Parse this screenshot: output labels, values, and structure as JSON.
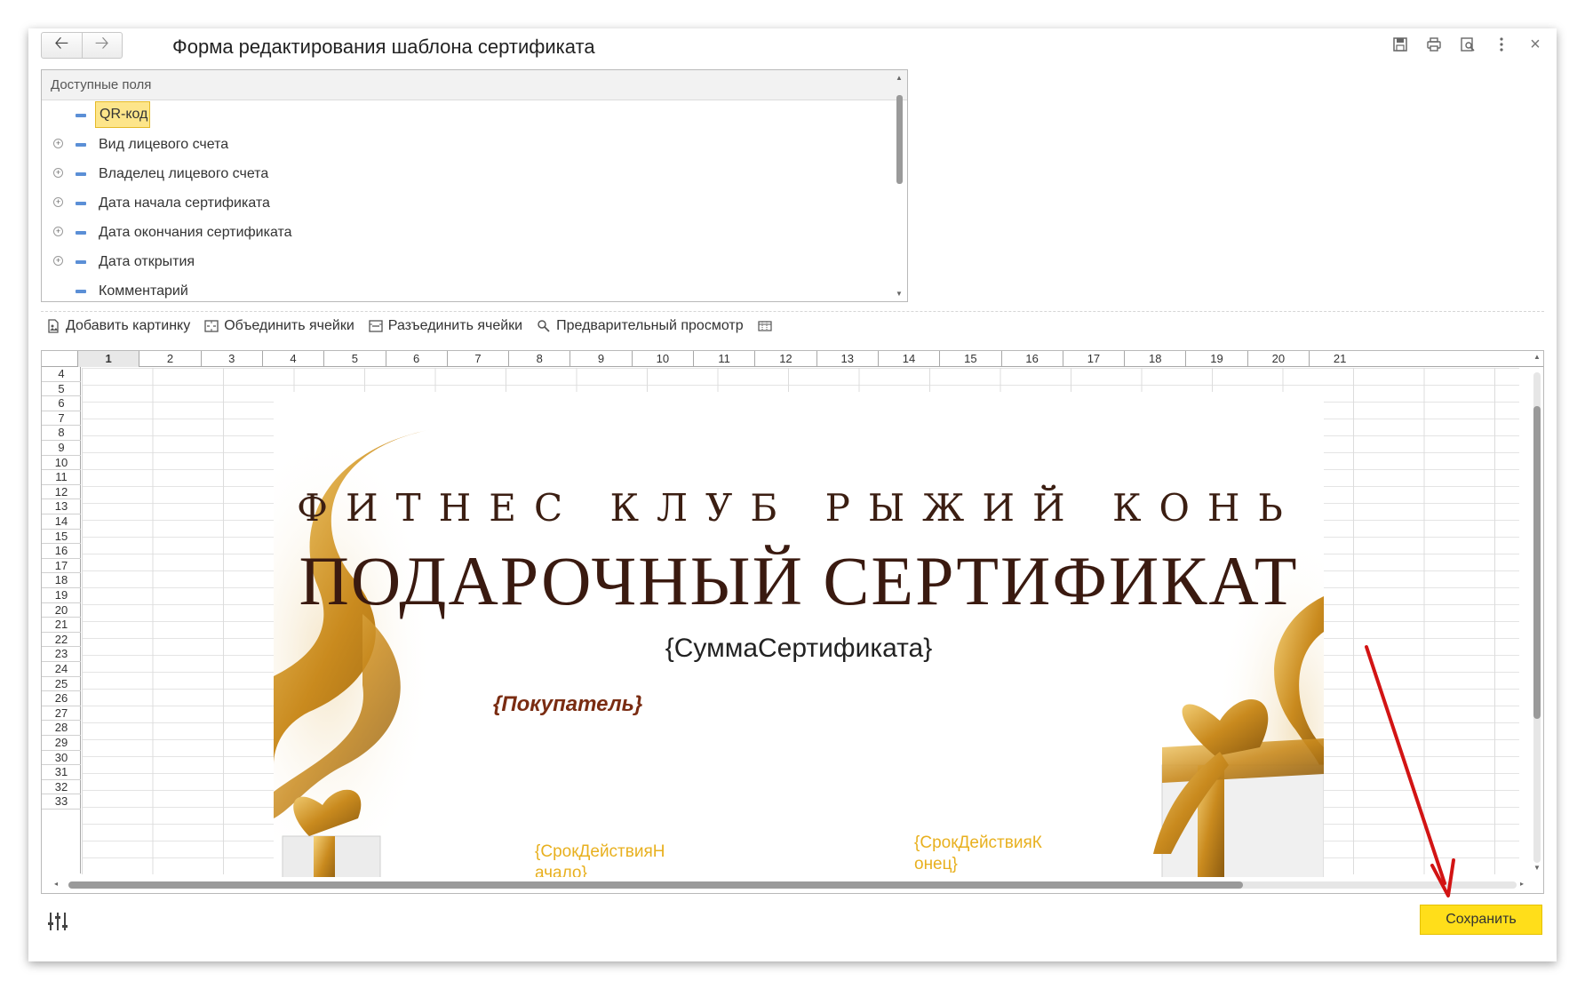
{
  "window": {
    "title": "Форма редактирования шаблона сертификата",
    "nav": {
      "back_icon": "arrow-left-icon",
      "forward_icon": "arrow-right-icon"
    },
    "tools": [
      "save-icon",
      "print-icon",
      "preview-icon",
      "more-icon",
      "close-icon"
    ],
    "close_glyph": "×"
  },
  "fields_panel": {
    "header": "Доступные поля",
    "items": [
      {
        "label": "QR-код",
        "expandable": false,
        "selected": true
      },
      {
        "label": "Вид лицевого счета",
        "expandable": true,
        "selected": false
      },
      {
        "label": "Владелец лицевого счета",
        "expandable": true,
        "selected": false
      },
      {
        "label": "Дата начала сертификата",
        "expandable": true,
        "selected": false
      },
      {
        "label": "Дата окончания сертификата",
        "expandable": true,
        "selected": false
      },
      {
        "label": "Дата открытия",
        "expandable": true,
        "selected": false
      },
      {
        "label": "Комментарий",
        "expandable": false,
        "selected": false
      }
    ]
  },
  "toolbar": {
    "add_picture": "Добавить картинку",
    "merge_cells": "Объединить ячейки",
    "split_cells": "Разъединить ячейки",
    "preview": "Предварительный просмотр"
  },
  "sheet": {
    "columns": [
      "1",
      "2",
      "3",
      "4",
      "5",
      "6",
      "7",
      "8",
      "9",
      "10",
      "11",
      "12",
      "13",
      "14",
      "15",
      "16",
      "17",
      "18",
      "19",
      "20",
      "21"
    ],
    "active_column": "1",
    "rows": [
      "4",
      "5",
      "6",
      "7",
      "8",
      "9",
      "10",
      "11",
      "12",
      "13",
      "14",
      "15",
      "16",
      "17",
      "18",
      "19",
      "20",
      "21",
      "22",
      "23",
      "24",
      "25",
      "26",
      "27",
      "28",
      "29",
      "30",
      "31",
      "32",
      "33"
    ]
  },
  "certificate": {
    "club": "ФИТНЕС КЛУБ РЫЖИЙ КОНЬ",
    "title": "ПОДАРОЧНЫЙ СЕРТИФИКАТ",
    "sum_field": "{СуммаСертификата}",
    "buyer_field": "{Покупатель}",
    "start_field_line1": "{СрокДействияН",
    "start_field_line2": "ачало}",
    "end_field_line1": "{СрокДействияК",
    "end_field_line2": "онец}",
    "colors": {
      "gold": "#d9a23a",
      "brown": "#3a1a10",
      "field_yellow": "#e8b01f",
      "buyer_red": "#7a2c12"
    }
  },
  "footer": {
    "save_label": "Сохранить",
    "settings_icon": "sliders-icon",
    "save_color": "#ffde1a"
  }
}
